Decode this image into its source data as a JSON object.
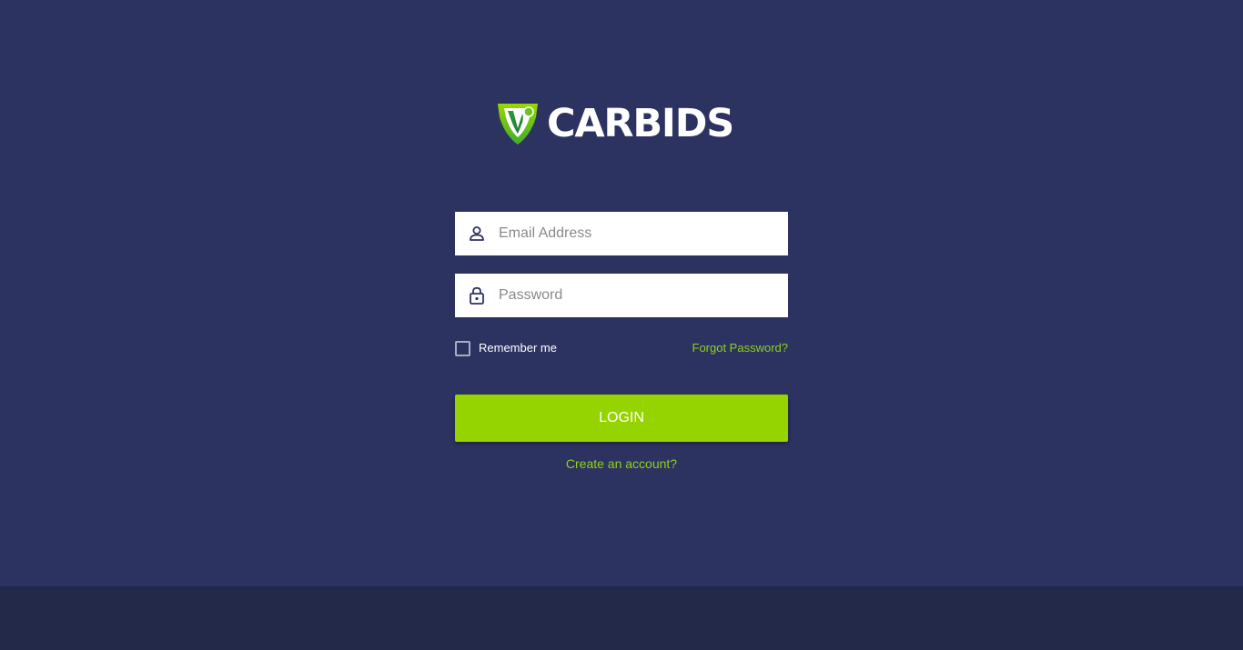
{
  "brand": {
    "name": "CARBIDS",
    "logo_icon": "carbids-shield-logo",
    "primary_color": "#96d400",
    "link_color": "#8cd21c",
    "background_color": "#2d3360",
    "footer_color": "#232949"
  },
  "form": {
    "email": {
      "icon": "user-icon",
      "placeholder": "Email Address",
      "value": ""
    },
    "password": {
      "icon": "lock-icon",
      "placeholder": "Password",
      "value": ""
    },
    "remember_me": {
      "label": "Remember me",
      "checked": false
    },
    "forgot_password_label": "Forgot Password?",
    "login_label": "LOGIN",
    "create_account_label": "Create an account?"
  }
}
